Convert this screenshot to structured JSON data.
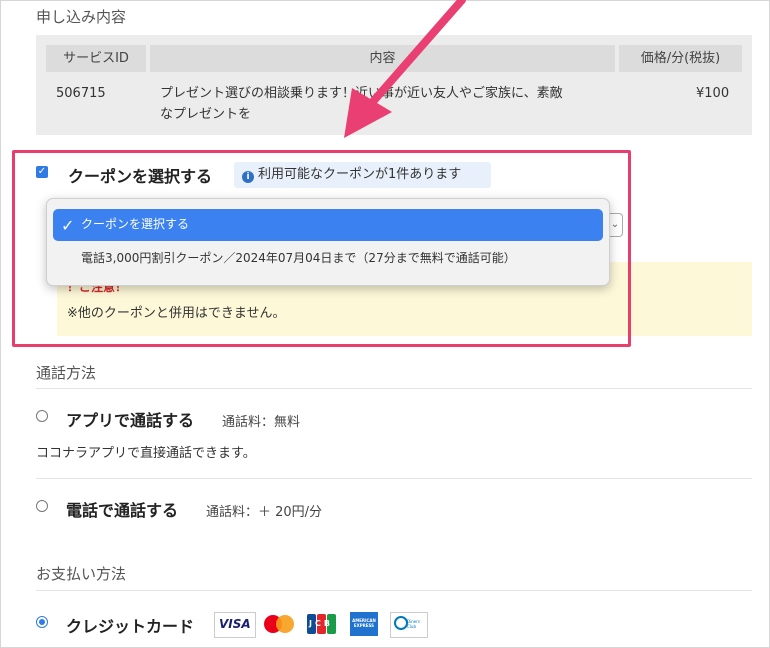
{
  "application": {
    "title": "申し込み内容",
    "table": {
      "headers": [
        "サービスID",
        "内容",
        "価格/分(税抜)"
      ],
      "row": {
        "id": "506715",
        "content_line1": "プレゼント選びの相談乗ります！近い事が近い友人やご家族に、素敵",
        "content_line2": "なプレゼントを",
        "price": "¥100"
      }
    }
  },
  "coupon": {
    "checkbox_label": "クーポンを選択する",
    "info_text": "利用可能なクーポンが1件あります",
    "dropdown": {
      "selected": "クーポンを選択する",
      "option": "電話3,000円割引クーポン／2024年07月04日まで（27分まで無料で通話可能）"
    },
    "notice_title": "！ご注意！",
    "notice_text": "※他のクーポンと併用はできません。"
  },
  "call_method": {
    "title": "通話方法",
    "app": {
      "label": "アプリで通話する",
      "fee": "通話料：無料",
      "desc": "ココナラアプリで直接通話できます。"
    },
    "phone": {
      "label": "電話で通話する",
      "fee": "通話料：＋ 20円/分"
    }
  },
  "payment": {
    "title": "お支払い方法",
    "credit_label": "クレジットカード",
    "cards": {
      "visa": "VISA",
      "jcb": "JCB",
      "amex": "AMERICAN EXPRESS",
      "diners": "Diners Club"
    }
  },
  "colors": {
    "highlight_border": "#e83e6d",
    "arrow": "#ea3f73",
    "accent": "#2f7ae5",
    "notice_bg": "#fdf8d8"
  }
}
